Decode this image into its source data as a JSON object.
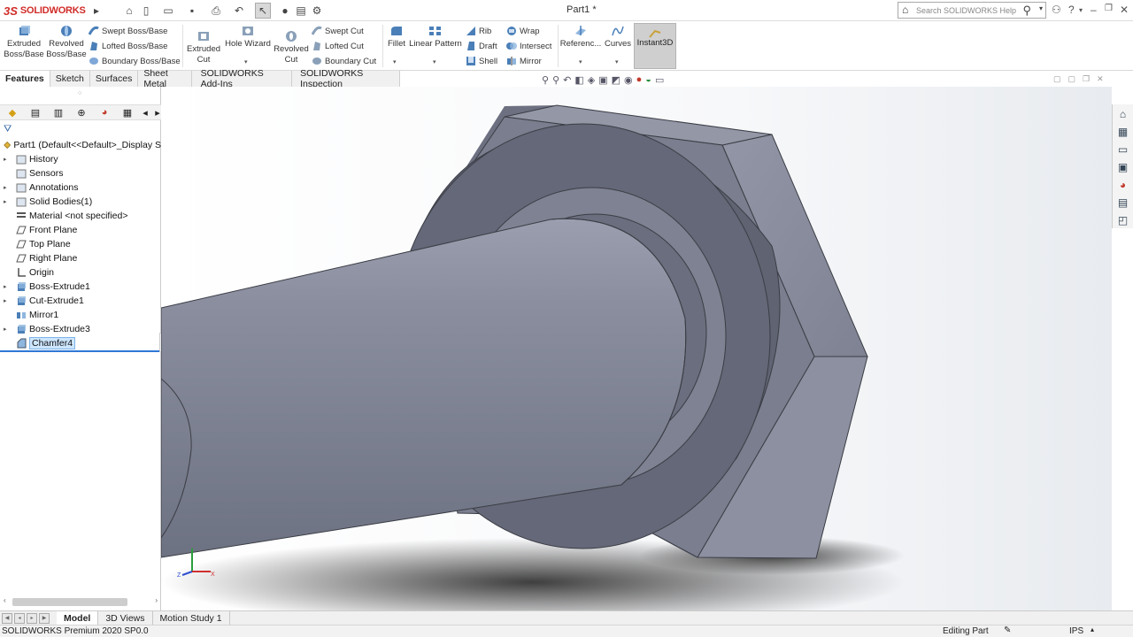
{
  "app": {
    "logo_text": "SOLIDWORKS",
    "logo_mark": "3S",
    "document_title": "Part1 *",
    "search_placeholder": "Search SOLIDWORKS Help"
  },
  "command_manager": {
    "extruded_boss": "Extruded\nBoss/Base",
    "revolved_boss": "Revolved\nBoss/Base",
    "swept_boss": "Swept Boss/Base",
    "lofted_boss": "Lofted Boss/Base",
    "boundary_boss": "Boundary Boss/Base",
    "extruded_cut": "Extruded\nCut",
    "hole_wizard": "Hole Wizard",
    "revolved_cut": "Revolved\nCut",
    "swept_cut": "Swept Cut",
    "lofted_cut": "Lofted Cut",
    "boundary_cut": "Boundary Cut",
    "fillet": "Fillet",
    "linear_pattern": "Linear Pattern",
    "rib": "Rib",
    "draft": "Draft",
    "shell": "Shell",
    "wrap": "Wrap",
    "intersect": "Intersect",
    "mirror": "Mirror",
    "reference": "Referenc...",
    "curves": "Curves",
    "instant3d": "Instant3D"
  },
  "tabs": [
    "Features",
    "Sketch",
    "Surfaces",
    "Sheet Metal",
    "SOLIDWORKS Add-Ins",
    "SOLIDWORKS Inspection"
  ],
  "feature_tree": {
    "root": "Part1  (Default<<Default>_Display S",
    "items": [
      {
        "label": "History",
        "expandable": true
      },
      {
        "label": "Sensors",
        "expandable": false
      },
      {
        "label": "Annotations",
        "expandable": true
      },
      {
        "label": "Solid Bodies(1)",
        "expandable": true
      },
      {
        "label": "Material <not specified>",
        "expandable": false
      },
      {
        "label": "Front Plane",
        "expandable": false
      },
      {
        "label": "Top Plane",
        "expandable": false
      },
      {
        "label": "Right Plane",
        "expandable": false
      },
      {
        "label": "Origin",
        "expandable": false
      },
      {
        "label": "Boss-Extrude1",
        "expandable": true
      },
      {
        "label": "Cut-Extrude1",
        "expandable": true
      },
      {
        "label": "Mirror1",
        "expandable": false
      },
      {
        "label": "Boss-Extrude3",
        "expandable": true
      },
      {
        "label": "Chamfer4",
        "expandable": false,
        "selected": true
      }
    ]
  },
  "bottom_tabs": [
    "Model",
    "3D Views",
    "Motion Study 1"
  ],
  "status": {
    "product": "SOLIDWORKS Premium 2020 SP0.0",
    "mode": "Editing Part",
    "units": "IPS"
  },
  "colors": {
    "brand_red": "#d02b27",
    "selection_blue": "#2f78d6",
    "model_face": "#8a8e9e"
  }
}
